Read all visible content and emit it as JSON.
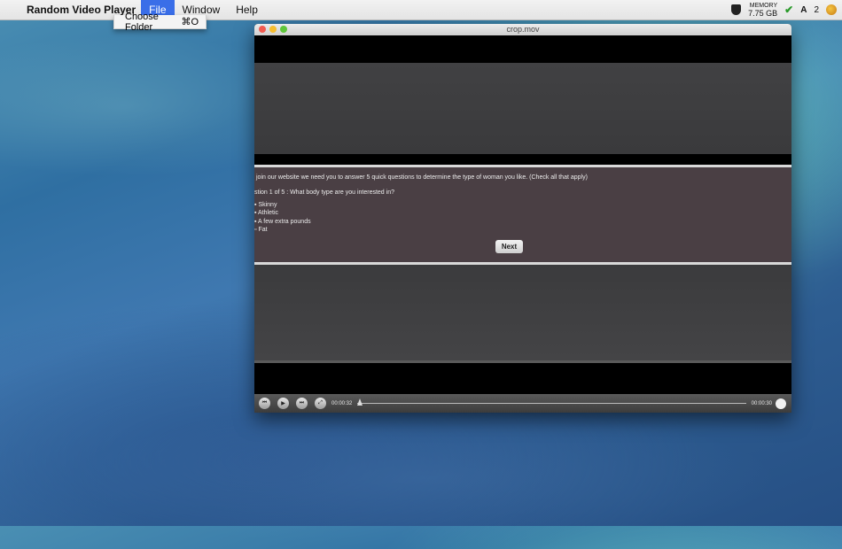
{
  "menubar": {
    "app_name": "Random Video Player",
    "menus": [
      "File",
      "Window",
      "Help"
    ],
    "active_menu": "File",
    "memory_label": "MEMORY",
    "memory_value": "7.75 GB",
    "status_badge": "2"
  },
  "file_menu": {
    "item_label": "Choose Folder",
    "item_shortcut": "⌘O"
  },
  "window": {
    "title": "crop.mov"
  },
  "video_dialog": {
    "intro": "join our website we need you to answer 5 quick questions to determine the type of woman you like. (Check all that apply)",
    "question": "stion 1 of 5 : What body type are you interested in?",
    "options": [
      "Skinny",
      "Athletic",
      "A few extra pounds",
      "Fat"
    ],
    "next_label": "Next"
  },
  "player": {
    "current_time": "00:00:32",
    "total_time": "00:00:30",
    "progress": 0.0
  }
}
